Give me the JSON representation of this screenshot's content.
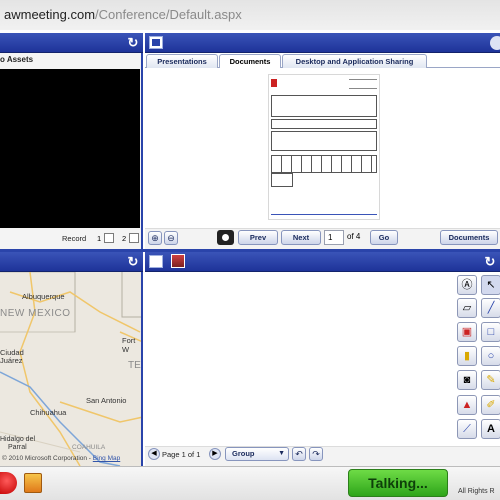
{
  "browser": {
    "url_host": "awmeeting.com",
    "url_path": "/Conference/Default.aspx"
  },
  "left_panel": {
    "title": "o Assets",
    "record_label": "Record",
    "record_1": "1",
    "record_2": "2"
  },
  "tabs": [
    "Presentations",
    "Documents",
    "Desktop and Application Sharing"
  ],
  "doc_nav": {
    "prev_label": "Prev",
    "next_label": "Next",
    "page_value": "1",
    "of_label": "of 4",
    "go_label": "Go",
    "documents_label": "Documents"
  },
  "map": {
    "labels": {
      "albuquerque": "Albuquerque",
      "new_mexico": "NEW MEXICO",
      "ciudad": "Ciudad",
      "juarez": "Juárez",
      "fort_worth": "Fort W",
      "tex": "TEX",
      "san_antonio": "San Antonio",
      "chihuahua": "Chihuahua",
      "hidalgo": "Hidalgo del",
      "parral": "Parral",
      "coahuila": "COAHUILA"
    },
    "copyright": "© 2010 Microsoft Corporation - ",
    "bing": "Bing Map"
  },
  "whiteboard": {
    "page_label": "Page 1 of 1",
    "group_value": "Group"
  },
  "footer": {
    "talking_label": "Talking...",
    "rights": "All Rights R"
  },
  "colors": {
    "panel_header": "#2a44aa",
    "talking": "#4cc22c"
  }
}
